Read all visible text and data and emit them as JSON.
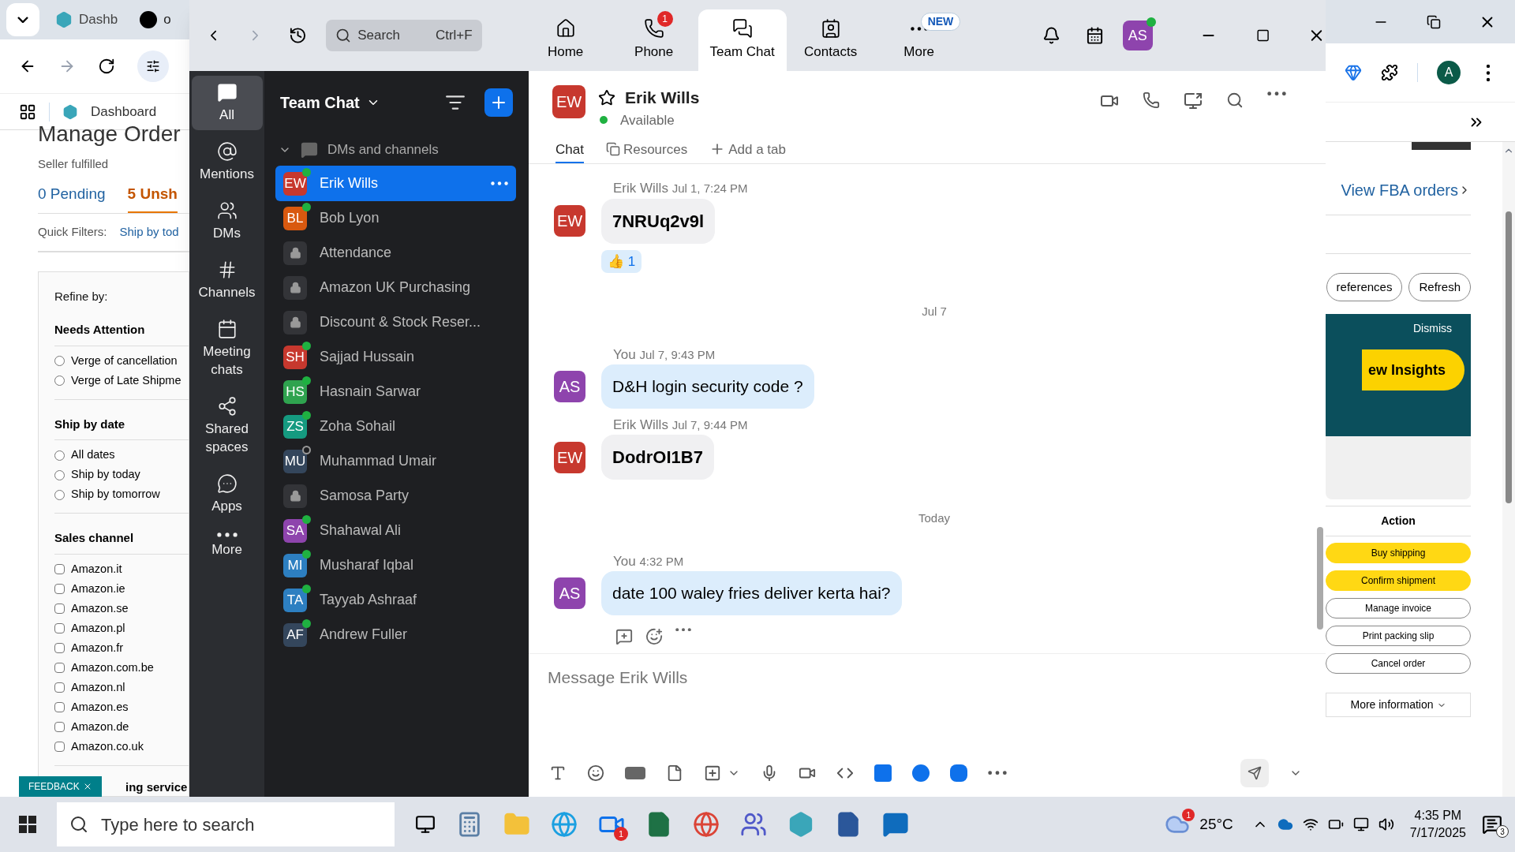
{
  "browser": {
    "tabs": [
      {
        "label": "Dashb",
        "selected": true
      },
      {
        "label": "o",
        "selected": false
      }
    ],
    "bookmark": "Dashboard",
    "profile": "A"
  },
  "page_left": {
    "heading": "Manage Order",
    "subheading": "Seller fulfilled",
    "order_tabs": [
      {
        "label": "0 Pending",
        "selected": false
      },
      {
        "label": "5 Unsh",
        "selected": true
      }
    ],
    "quick_filters_label": "Quick Filters:",
    "quick_filter": "Ship by tod",
    "refine_label": "Refine by:",
    "filter_groups": [
      {
        "title": "Needs Attention",
        "kind": "radio",
        "options": [
          {
            "label": "Verge of cancellation",
            "checked": false
          },
          {
            "label": "Verge of Late Shipme",
            "checked": false
          }
        ]
      },
      {
        "title": "Ship by date",
        "kind": "radio",
        "options": [
          {
            "label": "All dates",
            "checked": false
          },
          {
            "label": "Ship by today",
            "checked": false
          },
          {
            "label": "Ship by tomorrow",
            "checked": false
          }
        ]
      },
      {
        "title": "Sales channel",
        "kind": "checkbox",
        "options": [
          {
            "label": "Amazon.it",
            "checked": false
          },
          {
            "label": "Amazon.ie",
            "checked": false
          },
          {
            "label": "Amazon.se",
            "checked": false
          },
          {
            "label": "Amazon.pl",
            "checked": false
          },
          {
            "label": "Amazon.fr",
            "checked": false
          },
          {
            "label": "Amazon.com.be",
            "checked": false
          },
          {
            "label": "Amazon.nl",
            "checked": false
          },
          {
            "label": "Amazon.es",
            "checked": false
          },
          {
            "label": "Amazon.de",
            "checked": false
          },
          {
            "label": "Amazon.co.uk",
            "checked": false
          }
        ]
      }
    ],
    "feedback": "FEEDBACK",
    "next_group": "ing service"
  },
  "page_right": {
    "fba_link": "View FBA orders",
    "buttons": [
      "references",
      "Refresh"
    ],
    "banner": {
      "dismiss": "Dismiss",
      "cta": "ew Insights"
    },
    "action_header": "Action",
    "actions": [
      {
        "label": "Buy shipping",
        "primary": true
      },
      {
        "label": "Confirm shipment",
        "primary": true
      },
      {
        "label": "Manage invoice",
        "primary": false
      },
      {
        "label": "Print packing slip",
        "primary": false
      },
      {
        "label": "Cancel order",
        "primary": false
      }
    ],
    "more_info": "More information"
  },
  "zoom": {
    "nav": {
      "search": {
        "placeholder": "Search",
        "shortcut": "Ctrl+F"
      },
      "tabs": [
        {
          "label": "Home",
          "selected": false
        },
        {
          "label": "Phone",
          "selected": false,
          "badge": "1"
        },
        {
          "label": "Team Chat",
          "selected": true
        },
        {
          "label": "Contacts",
          "selected": false
        },
        {
          "label": "More",
          "selected": false,
          "tag": "NEW"
        }
      ],
      "avatar": "AS"
    },
    "rail": [
      {
        "label": "All",
        "selected": true
      },
      {
        "label": "Mentions",
        "selected": false
      },
      {
        "label": "DMs",
        "selected": false
      },
      {
        "label": "Channels",
        "selected": false
      },
      {
        "label": "Meeting chats",
        "selected": false
      },
      {
        "label": "Shared spaces",
        "selected": false
      },
      {
        "label": "Apps",
        "selected": false
      },
      {
        "label": "More",
        "selected": false
      }
    ],
    "list": {
      "title": "Team Chat",
      "section": "DMs and channels",
      "items": [
        {
          "kind": "person",
          "initials": "EW",
          "name": "Erik Wills",
          "color": "#c7382e",
          "online": true,
          "selected": true
        },
        {
          "kind": "person",
          "initials": "BL",
          "name": "Bob Lyon",
          "color": "#d9590f",
          "online": true,
          "selected": false
        },
        {
          "kind": "channel",
          "name": "Attendance",
          "selected": false
        },
        {
          "kind": "channel",
          "name": "Amazon UK Purchasing",
          "selected": false
        },
        {
          "kind": "channel",
          "name": "Discount & Stock Reser...",
          "selected": false
        },
        {
          "kind": "person",
          "initials": "SH",
          "name": "Sajjad Hussain",
          "color": "#c7382e",
          "online": true,
          "selected": false
        },
        {
          "kind": "person",
          "initials": "HS",
          "name": "Hasnain Sarwar",
          "color": "#2fa34f",
          "online": true,
          "selected": false
        },
        {
          "kind": "person",
          "initials": "ZS",
          "name": "Zoha Sohail",
          "color": "#159a80",
          "online": true,
          "selected": false
        },
        {
          "kind": "person",
          "initials": "MU",
          "name": "Muhammad Umair",
          "color": "#34465c",
          "online": false,
          "selected": false
        },
        {
          "kind": "channel",
          "name": "Samosa Party",
          "selected": false
        },
        {
          "kind": "person",
          "initials": "SA",
          "name": "Shahawal Ali",
          "color": "#8e44ad",
          "online": true,
          "selected": false
        },
        {
          "kind": "person",
          "initials": "MI",
          "name": "Musharaf Iqbal",
          "color": "#2d7fc1",
          "online": true,
          "selected": false
        },
        {
          "kind": "person",
          "initials": "TA",
          "name": "Tayyab Ashraaf",
          "color": "#2d7fc1",
          "online": true,
          "selected": false
        },
        {
          "kind": "person",
          "initials": "AF",
          "name": "Andrew Fuller",
          "color": "#34465c",
          "online": true,
          "selected": false
        }
      ]
    },
    "chat": {
      "contact": {
        "initials": "EW",
        "name": "Erik Wills",
        "status": "Available"
      },
      "tabs": [
        {
          "label": "Chat",
          "selected": true
        },
        {
          "label": "Resources",
          "selected": false
        },
        {
          "label": "Add a tab",
          "selected": false
        }
      ],
      "messages": [
        {
          "kind": "message",
          "sender": "Erik Wills",
          "time": "Jul 1, 7:24 PM",
          "initials": "EW",
          "mine": false,
          "bold": true,
          "text": "7NRUq2v9l",
          "reaction": {
            "emoji": "👍",
            "count": "1"
          }
        },
        {
          "kind": "date",
          "text": "Jul 7"
        },
        {
          "kind": "message",
          "sender": "You",
          "time": "Jul 7, 9:43 PM",
          "initials": "AS",
          "mine": true,
          "bold": false,
          "text": "D&H login security code ?"
        },
        {
          "kind": "message",
          "sender": "Erik Wills",
          "time": "Jul 7, 9:44 PM",
          "initials": "EW",
          "mine": false,
          "bold": true,
          "text": "DodrOI1B7"
        },
        {
          "kind": "date",
          "text": "Today"
        },
        {
          "kind": "message",
          "sender": "You",
          "time": "4:32 PM",
          "initials": "AS",
          "mine": true,
          "bold": false,
          "text": "date 100 waley fries deliver kerta hai?"
        }
      ],
      "composer": {
        "placeholder": "Message Erik Wills"
      }
    }
  },
  "taskbar": {
    "search_placeholder": "Type here to search",
    "zoom_badge": "1",
    "weather_badge": "1",
    "temperature": "25°C",
    "time": "4:35 PM",
    "date": "7/17/2025",
    "notifications": "3"
  }
}
